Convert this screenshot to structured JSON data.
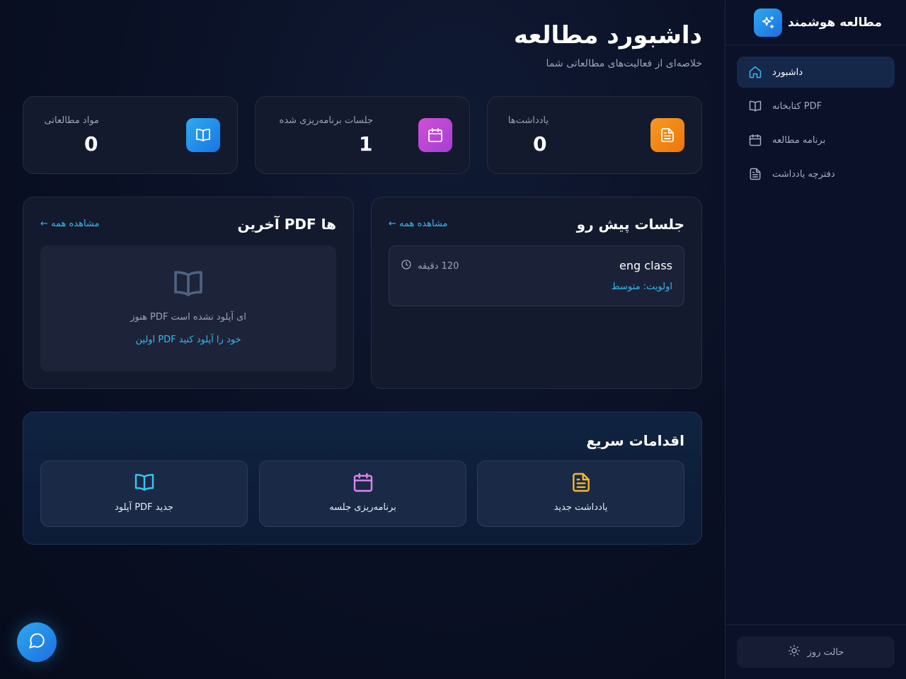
{
  "app": {
    "brand": "مطالعه هوشمند"
  },
  "sidebar": {
    "items": [
      {
        "label": "داشبورد",
        "icon": "home-icon",
        "active": true
      },
      {
        "label": "کتابخانه PDF",
        "icon": "book-icon",
        "active": false
      },
      {
        "label": "برنامه مطالعه",
        "icon": "calendar-icon",
        "active": false
      },
      {
        "label": "دفترچه یادداشت",
        "icon": "file-text-icon",
        "active": false
      }
    ],
    "theme_toggle": "حالت روز"
  },
  "header": {
    "title": "داشبورد مطالعه",
    "subtitle": "خلاصه‌ای از فعالیت‌های مطالعاتی شما"
  },
  "stats": [
    {
      "label": "یادداشت‌ها",
      "value": "0",
      "icon": "file-text-icon",
      "color": "#f28a16"
    },
    {
      "label": "جلسات برنامه‌ریزی شده",
      "value": "1",
      "icon": "calendar-icon",
      "color": "#c64ad6"
    },
    {
      "label": "مواد مطالعاتی",
      "value": "0",
      "icon": "book-icon",
      "color": "#2b8ff0"
    }
  ],
  "upcoming": {
    "title": "جلسات پیش رو",
    "view_all": "← مشاهده همه",
    "sessions": [
      {
        "name": "eng class",
        "duration": "120 دقیقه",
        "priority": "اولویت: متوسط"
      }
    ]
  },
  "recent_pdfs": {
    "title": "آخرین PDF ها",
    "view_all": "← مشاهده همه",
    "empty_text": "هنوز PDF ای آپلود نشده است",
    "empty_link": "اولین PDF خود را آپلود کنید"
  },
  "quick_actions": {
    "title": "اقدامات سریع",
    "items": [
      {
        "label": "یادداشت جدید",
        "icon": "file-text-icon",
        "color": "#f5b82e"
      },
      {
        "label": "برنامه‌ریزی جلسه",
        "icon": "calendar-icon",
        "color": "#d987f0"
      },
      {
        "label": "آپلود PDF جدید",
        "icon": "book-icon",
        "color": "#3cc4f5"
      }
    ]
  }
}
